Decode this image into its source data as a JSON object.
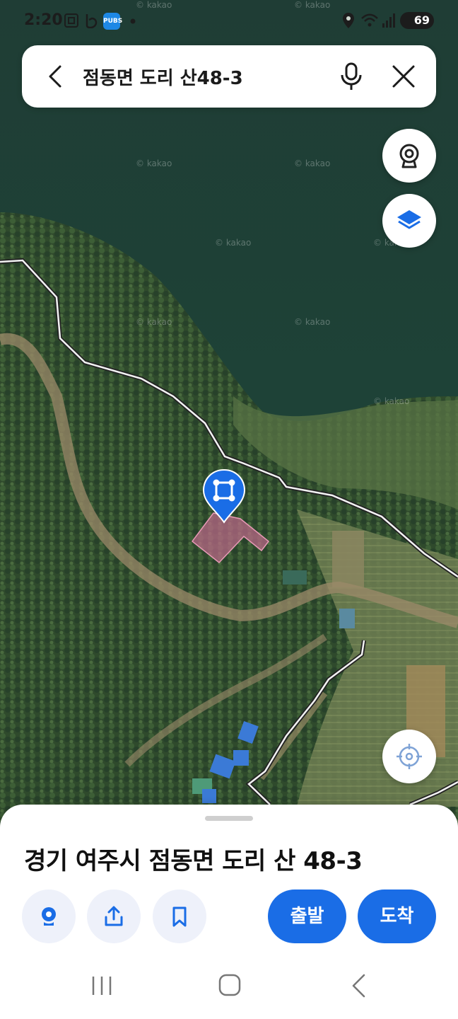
{
  "status_bar": {
    "time": "2:20",
    "battery": "69",
    "app_badge": "PUBS"
  },
  "search": {
    "query": "점동면 도리 산48-3"
  },
  "map": {
    "watermark": "© kakao",
    "parcel_color": "#c06a8c",
    "marker_color": "#1a6de6"
  },
  "place": {
    "address": "경기 여주시 점동면 도리 산 48-3",
    "depart_label": "출발",
    "arrive_label": "도착"
  },
  "colors": {
    "accent": "#1a6de6",
    "action_bg": "#eef1fa"
  }
}
